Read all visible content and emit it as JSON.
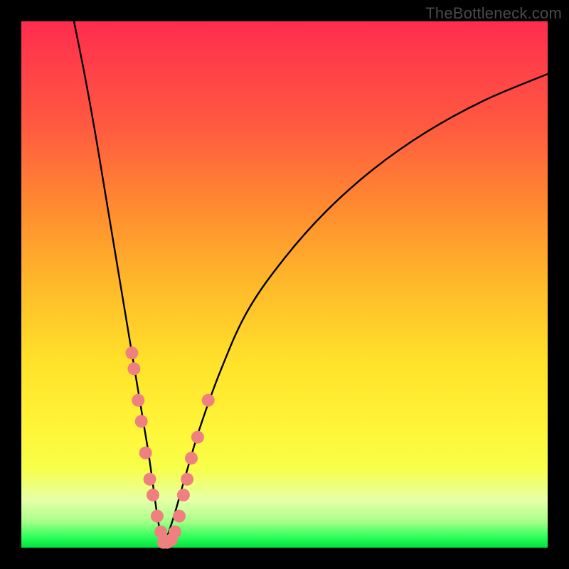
{
  "watermark": "TheBottleneck.com",
  "colors": {
    "frame": "#000000",
    "curve_stroke": "#000000",
    "marker_fill": "#f08080",
    "marker_stroke": "#aa4646"
  },
  "chart_data": {
    "type": "line",
    "title": "",
    "xlabel": "",
    "ylabel": "",
    "xlim": [
      0,
      100
    ],
    "ylim": [
      0,
      100
    ],
    "note": "V-shaped bottleneck curve with minimum near x≈27; background gradient maps y to bottleneck severity (top=red=high, bottom=green=low). Axes are unlabeled. Markers are sample points clustered near the minimum.",
    "series": [
      {
        "name": "left-branch",
        "x": [
          10,
          12,
          14,
          16,
          18,
          20,
          22,
          24,
          25,
          26,
          27
        ],
        "y": [
          100,
          90,
          79,
          67,
          55,
          43,
          31,
          19,
          12,
          5,
          0
        ]
      },
      {
        "name": "right-branch",
        "x": [
          27,
          29,
          31,
          34,
          38,
          43,
          50,
          58,
          67,
          77,
          88,
          100
        ],
        "y": [
          0,
          6,
          13,
          23,
          34,
          45,
          55,
          64,
          72,
          79,
          85,
          90
        ]
      }
    ],
    "markers": {
      "name": "sample-points",
      "points": [
        {
          "x": 21.0,
          "y": 37
        },
        {
          "x": 21.4,
          "y": 34
        },
        {
          "x": 22.2,
          "y": 28
        },
        {
          "x": 22.8,
          "y": 24
        },
        {
          "x": 23.6,
          "y": 18
        },
        {
          "x": 24.4,
          "y": 13
        },
        {
          "x": 25.0,
          "y": 10
        },
        {
          "x": 25.8,
          "y": 6
        },
        {
          "x": 26.5,
          "y": 3
        },
        {
          "x": 27.0,
          "y": 1
        },
        {
          "x": 27.7,
          "y": 1
        },
        {
          "x": 28.5,
          "y": 1.5
        },
        {
          "x": 29.2,
          "y": 3
        },
        {
          "x": 30.0,
          "y": 6
        },
        {
          "x": 30.8,
          "y": 10
        },
        {
          "x": 31.5,
          "y": 13
        },
        {
          "x": 32.3,
          "y": 17
        },
        {
          "x": 33.5,
          "y": 21
        },
        {
          "x": 35.5,
          "y": 28
        }
      ]
    }
  }
}
